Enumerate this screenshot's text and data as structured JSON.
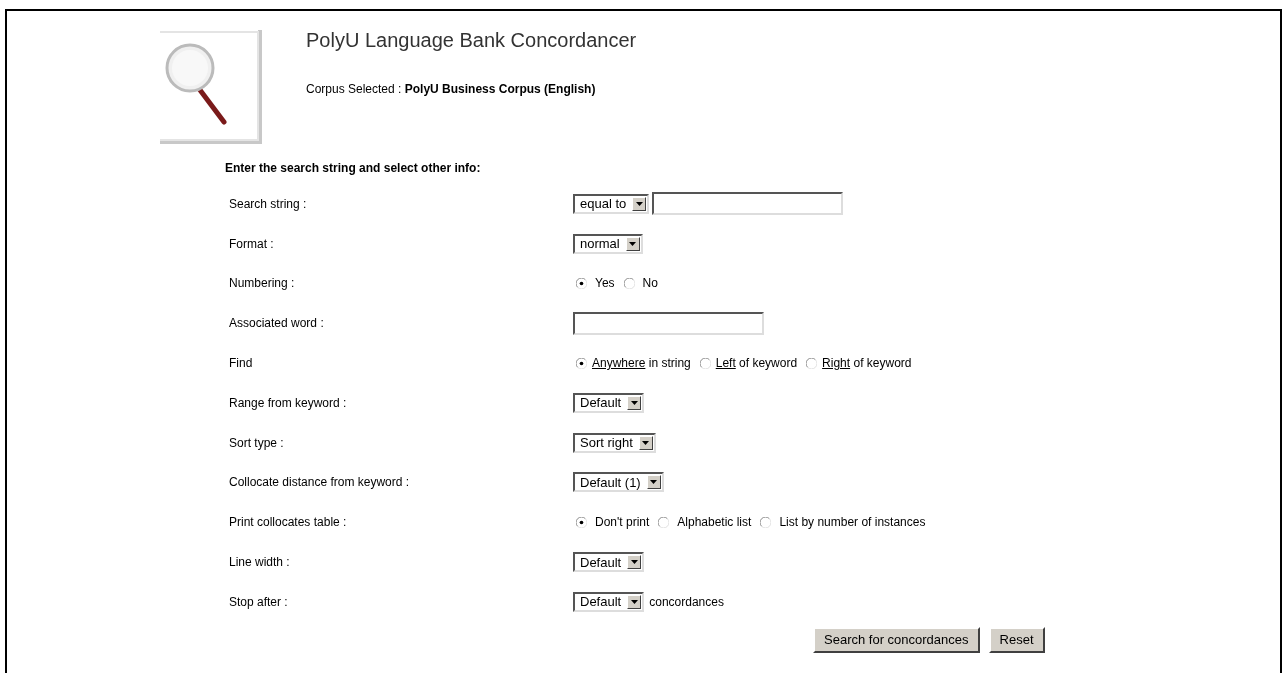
{
  "header": {
    "title": "PolyU Language Bank Concordancer",
    "corpus_label": "Corpus Selected :",
    "corpus_name": "PolyU Business Corpus (English)"
  },
  "form": {
    "heading": "Enter the search string and select other info:",
    "rows": [
      {
        "label": "Search string :",
        "kind": "select-input",
        "select": "equal to"
      },
      {
        "label": "Format :",
        "kind": "select",
        "select": "normal"
      },
      {
        "label": "Numbering :",
        "kind": "radio",
        "options": [
          {
            "label": "Yes",
            "selected": true
          },
          {
            "label": "No",
            "selected": false
          }
        ]
      },
      {
        "label": "Associated word :",
        "kind": "input"
      },
      {
        "label": "Find",
        "kind": "radio",
        "options": [
          {
            "underlined": "Anywhere",
            "label": "in string",
            "selected": true
          },
          {
            "underlined": "Left",
            "label": "of keyword",
            "selected": false
          },
          {
            "underlined": "Right",
            "label": "of keyword",
            "selected": false
          }
        ]
      },
      {
        "label": "Range from keyword :",
        "kind": "select",
        "select": "Default"
      },
      {
        "label": "Sort type :",
        "kind": "select",
        "select": "Sort right"
      },
      {
        "label": "Collocate distance from keyword :",
        "kind": "select",
        "select": "Default (1)"
      },
      {
        "label": "Print collocates table :",
        "kind": "radio",
        "options": [
          {
            "label": "Don't print",
            "selected": true
          },
          {
            "label": "Alphabetic list",
            "selected": false
          },
          {
            "label": "List by number of instances",
            "selected": false
          }
        ]
      },
      {
        "label": "Line width :",
        "kind": "select",
        "select": "Default"
      },
      {
        "label": "Stop after :",
        "kind": "select",
        "select": "Default",
        "suffix": "concordances"
      }
    ],
    "buttons": [
      "Search for concordances",
      "Reset"
    ]
  }
}
